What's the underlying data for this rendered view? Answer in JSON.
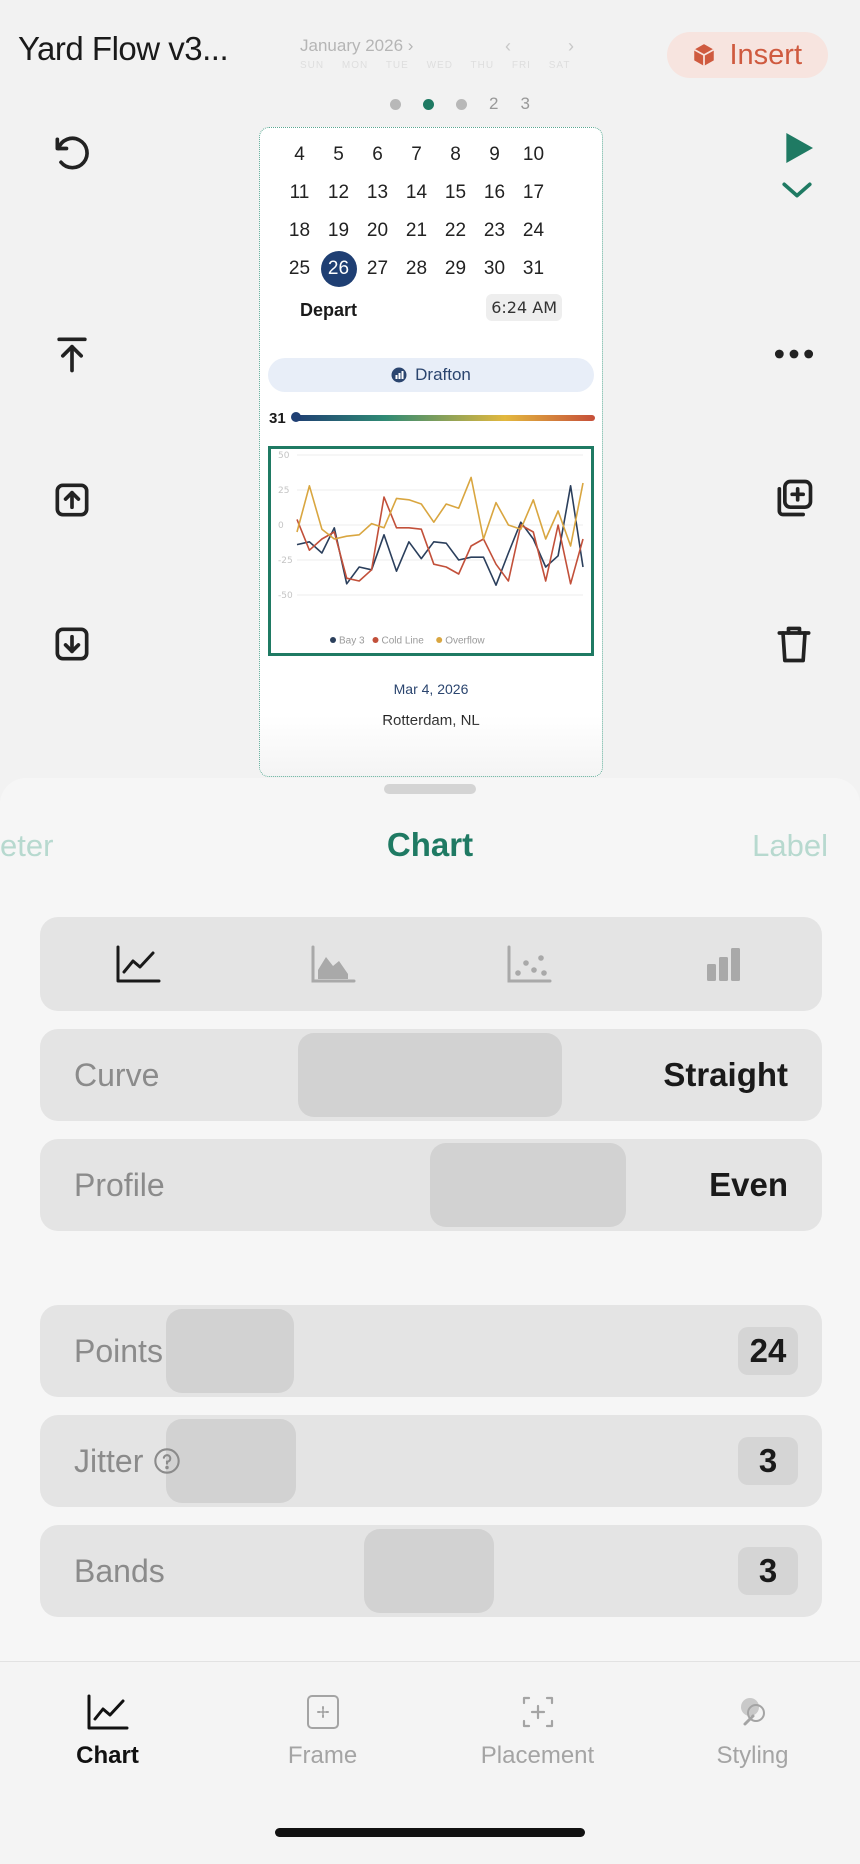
{
  "header": {
    "app_title": "Yard Flow v3...",
    "insert_label": "Insert",
    "calendar_month": "January 2026 ›",
    "calendar_nav": "‹ ›",
    "weekdays": "SUN MON TUE WED THU FRI SAT"
  },
  "pager": {
    "pages": [
      "2",
      "3"
    ],
    "active_index": 1
  },
  "preview": {
    "calendar_rows": [
      [
        "4",
        "5",
        "6",
        "7",
        "8",
        "9",
        "10"
      ],
      [
        "11",
        "12",
        "13",
        "14",
        "15",
        "16",
        "17"
      ],
      [
        "18",
        "19",
        "20",
        "21",
        "22",
        "23",
        "24"
      ],
      [
        "25",
        "26",
        "27",
        "28",
        "29",
        "30",
        "31"
      ]
    ],
    "selected_day": "26",
    "depart_label": "Depart",
    "time": "6:24 AM",
    "location_chip": "Drafton",
    "gradient_label": "31",
    "date": "Mar 4, 2026",
    "place": "Rotterdam, NL"
  },
  "chart_data": {
    "type": "line",
    "x": [
      1,
      2,
      3,
      4,
      5,
      6,
      7,
      8,
      9,
      10,
      11,
      12,
      13,
      14,
      15,
      16,
      17,
      18,
      19,
      20,
      21,
      22,
      23,
      24
    ],
    "ylim": [
      -50,
      50
    ],
    "yticks": [
      "50",
      "25",
      "0",
      "-25",
      "-50"
    ],
    "grid": true,
    "legend_position": "bottom",
    "series": [
      {
        "name": "Bay 3",
        "color": "#2b3f5c",
        "values": [
          -14,
          -12,
          -20,
          -2,
          -42,
          -30,
          -32,
          -7,
          -33,
          -12,
          -24,
          -12,
          -13,
          -25,
          -23,
          -23,
          -43,
          -20,
          2,
          -10,
          -30,
          -22,
          28,
          -30
        ]
      },
      {
        "name": "Cold Line",
        "color": "#c2503a",
        "values": [
          4,
          -18,
          -10,
          -5,
          -38,
          -40,
          -32,
          20,
          -2,
          -2,
          -3,
          -28,
          -30,
          -35,
          -15,
          -10,
          -28,
          -40,
          0,
          -5,
          -40,
          0,
          -42,
          -10
        ]
      },
      {
        "name": "Overflow",
        "color": "#d9a640",
        "values": [
          -5,
          28,
          -3,
          -10,
          -8,
          -7,
          1,
          -2,
          19,
          18,
          15,
          2,
          15,
          12,
          34,
          -10,
          16,
          0,
          -3,
          18,
          -10,
          10,
          -15,
          30
        ]
      }
    ]
  },
  "sheet": {
    "tab_left": "eter",
    "tab_center": "Chart",
    "tab_right": "Label",
    "chart_types": [
      "line-chart-icon",
      "area-chart-icon",
      "scatter-chart-icon",
      "bar-chart-icon"
    ],
    "curve": {
      "label": "Curve",
      "value": "Straight"
    },
    "profile": {
      "label": "Profile",
      "value": "Even"
    },
    "points": {
      "label": "Points",
      "value": "24"
    },
    "jitter": {
      "label": "Jitter",
      "value": "3"
    },
    "bands": {
      "label": "Bands",
      "value": "3"
    }
  },
  "nav": {
    "items": [
      {
        "label": "Chart",
        "icon": "line-chart-icon"
      },
      {
        "label": "Frame",
        "icon": "frame-icon"
      },
      {
        "label": "Placement",
        "icon": "placement-icon"
      },
      {
        "label": "Styling",
        "icon": "styling-icon"
      }
    ]
  },
  "colors": {
    "accent": "#1f7a63",
    "insert": "#cf5a3f",
    "selected_day": "#1f3f73"
  }
}
